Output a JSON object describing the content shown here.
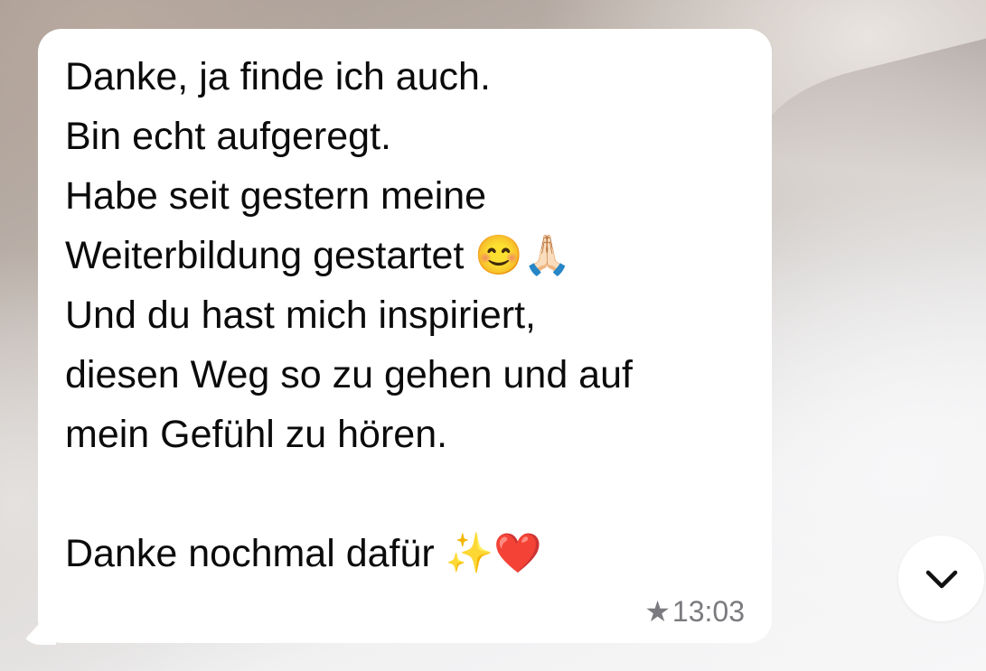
{
  "message": {
    "text": "Danke, ja finde ich auch.\nBin echt aufgeregt.\nHabe seit gestern meine\nWeiterbildung gestartet 😊🙏🏻\nUnd du hast mich inspiriert,\ndiesen Weg so zu gehen und auf\nmein Gefühl zu hören.\n\nDanke nochmal dafür ✨❤️",
    "starred_icon": "★",
    "time": "13:03"
  },
  "scroll_button": {
    "icon": "chevron-down-icon"
  },
  "colors": {
    "bubble": "#ffffff",
    "text": "#0b0b0b",
    "meta": "#7b7b7f"
  }
}
